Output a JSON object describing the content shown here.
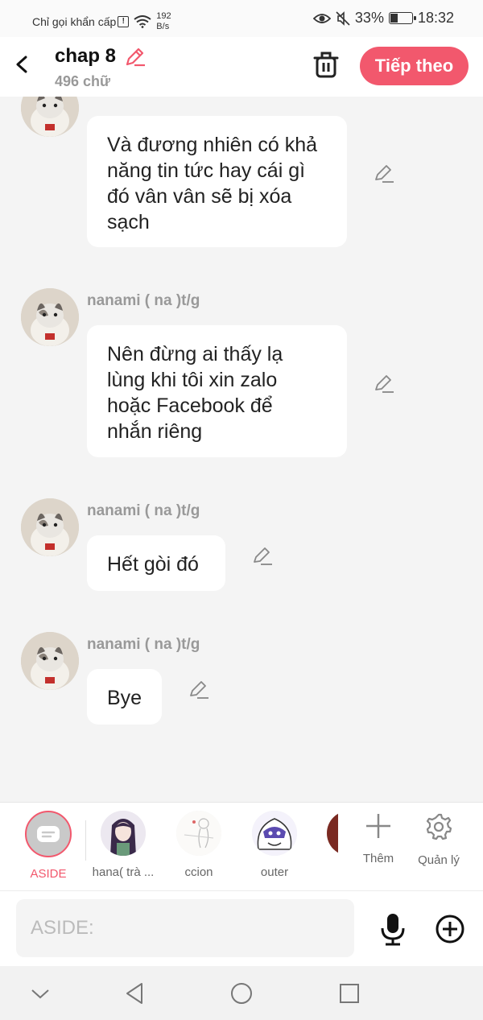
{
  "status_bar": {
    "carrier": "Chỉ gọi khẩn cấp",
    "alert": "!",
    "net_speed_value": "192",
    "net_speed_unit": "B/s",
    "battery": "33%",
    "battery_level": 0.33,
    "time": "18:32"
  },
  "header": {
    "title": "chap 8",
    "subtitle": "496 chữ",
    "next_label": "Tiếp theo"
  },
  "messages": [
    {
      "name": "",
      "text_lines": [
        "Và đương nhiên có khả",
        "năng tin tức hay cái gì",
        "đó vân vân sẽ bị xóa",
        "sạch"
      ]
    },
    {
      "name": "nanami ( na )t/g",
      "text_lines": [
        "Nên đừng ai thấy lạ",
        "lùng khi tôi xin zalo",
        "hoặc Facebook để",
        "nhắn riêng"
      ]
    },
    {
      "name": "nanami ( na )t/g",
      "text_lines": [
        "Hết gòi đó"
      ]
    },
    {
      "name": "nanami ( na )t/g",
      "text_lines": [
        "Bye"
      ]
    }
  ],
  "characters": [
    {
      "label": "ASIDE"
    },
    {
      "label": "hana( trà ..."
    },
    {
      "label": "ccion"
    },
    {
      "label": "outer"
    }
  ],
  "tools": {
    "add_label": "Thêm",
    "manage_label": "Quản lý"
  },
  "composer": {
    "placeholder": "ASIDE:"
  },
  "colors": {
    "accent": "#f2586d",
    "background": "#f4f4f4",
    "bubble": "#ffffff"
  }
}
